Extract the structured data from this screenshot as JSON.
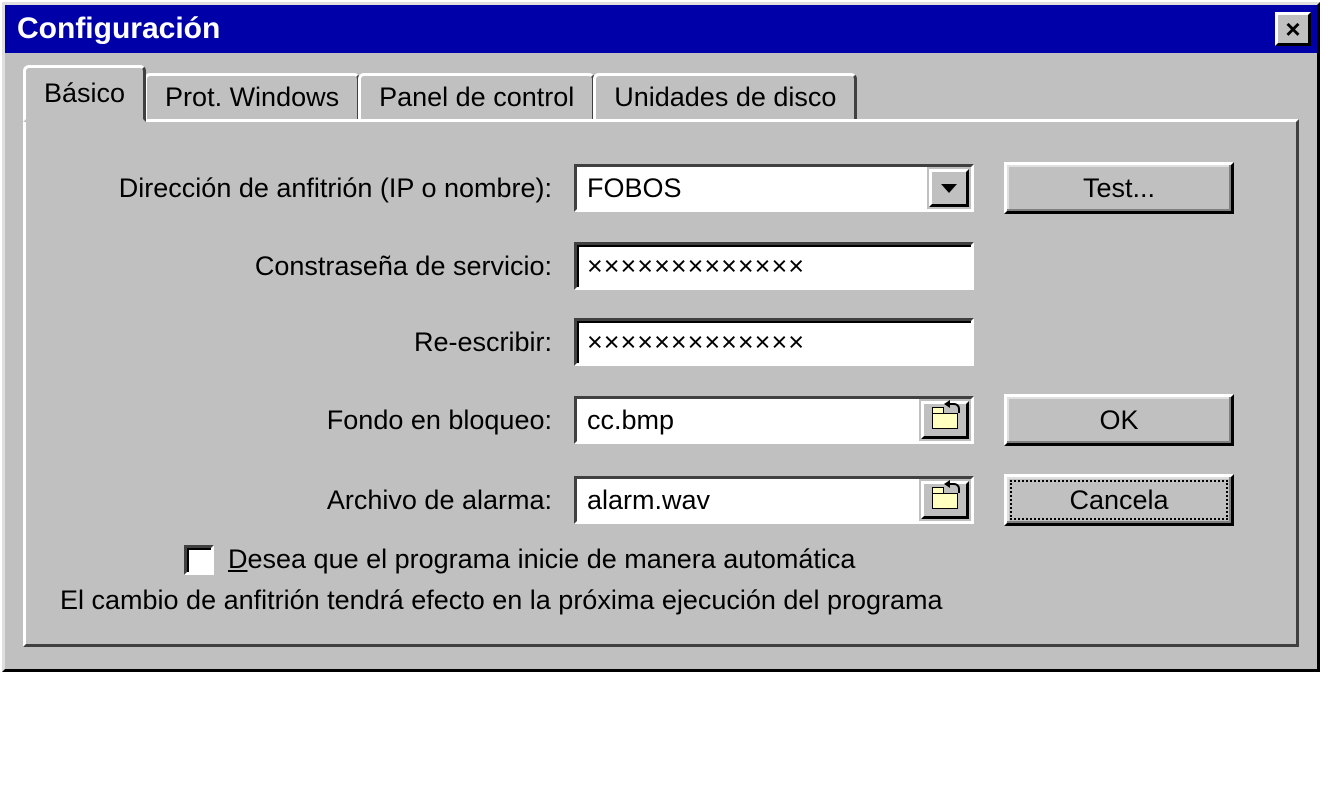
{
  "window": {
    "title": "Configuración"
  },
  "tabs": {
    "t0": "Básico",
    "t1": "Prot. Windows",
    "t2": "Panel de control",
    "t3": "Unidades de disco"
  },
  "labels": {
    "host": "Dirección de anfitrión (IP o nombre):",
    "password": "Constraseña de servicio:",
    "rewrite": "Re-escribir:",
    "lockbg": "Fondo en bloqueo:",
    "alarm": "Archivo de alarma:"
  },
  "fields": {
    "host_value": "FOBOS",
    "password_value": "×××××××××××××",
    "rewrite_value": "×××××××××××××",
    "lockbg_value": "cc.bmp",
    "alarm_value": "alarm.wav"
  },
  "buttons": {
    "test": "Test...",
    "ok": "OK",
    "cancel": "Cancela"
  },
  "checkbox": {
    "prefix": "D",
    "rest": "esea que el programa inicie de manera automática"
  },
  "note": "El cambio de anfitrión tendrá efecto en la próxima ejecución del programa"
}
